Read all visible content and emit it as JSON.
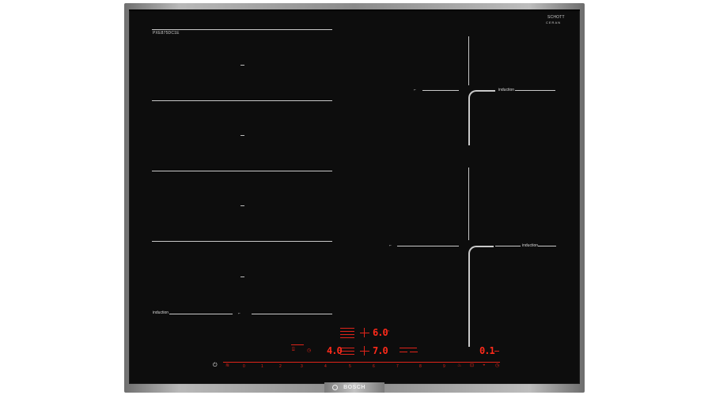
{
  "hob": {
    "brand": "BOSCH",
    "model_number": "PXE875DC1E",
    "glass_brand": {
      "line1": "SCHOTT",
      "line2": "CERAN"
    },
    "left_zone": {
      "bottom_label": "induction"
    },
    "right_zones": {
      "top_label": "induction",
      "bottom_label": "induction"
    },
    "controls": {
      "timer_display": "6.0",
      "power_display_left": "4.0",
      "power_display_mid": "7.0",
      "right_display": "0.1",
      "scale": [
        "0",
        "1",
        "2",
        "3",
        "4",
        "5",
        "6",
        "7",
        "8",
        "9"
      ],
      "accent_color": "#e0241a"
    }
  }
}
